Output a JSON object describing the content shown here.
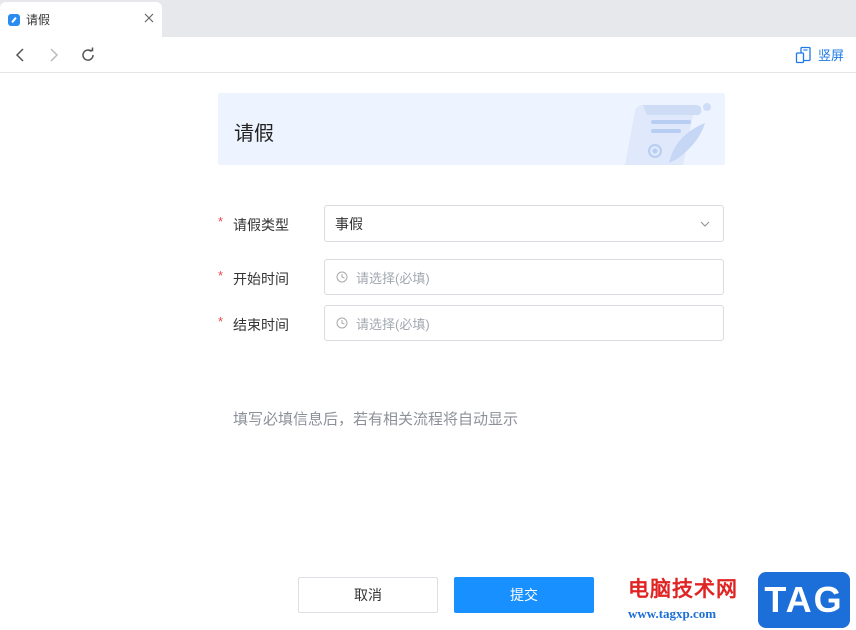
{
  "browser": {
    "tab_title": "请假",
    "portrait_label": "竖屏"
  },
  "banner": {
    "title": "请假"
  },
  "form": {
    "required_mark": "*",
    "leave_type": {
      "label": "请假类型",
      "value": "事假"
    },
    "start_time": {
      "label": "开始时间",
      "placeholder": "请选择(必填)"
    },
    "end_time": {
      "label": "结束时间",
      "placeholder": "请选择(必填)"
    }
  },
  "hint": "填写必填信息后，若有相关流程将自动显示",
  "footer": {
    "cancel_label": "取消",
    "submit_label": "提交"
  },
  "watermark": {
    "site_name": "电脑技术网",
    "url": "www.tagxp.com",
    "badge": "TAG"
  },
  "colors": {
    "accent": "#1890ff",
    "required": "#e5484d",
    "banner_bg": "#eef4ff"
  }
}
